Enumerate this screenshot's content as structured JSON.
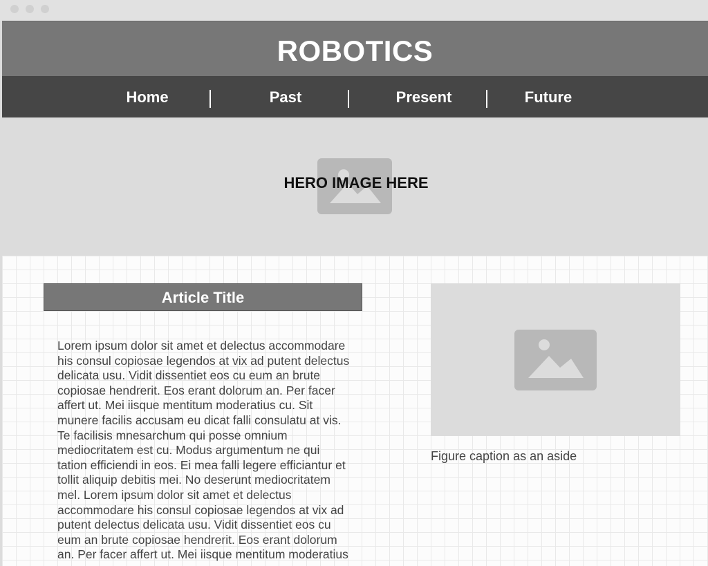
{
  "header": {
    "title": "ROBOTICS"
  },
  "nav": {
    "items": [
      {
        "label": "Home"
      },
      {
        "label": "Past"
      },
      {
        "label": "Present"
      },
      {
        "label": "Future"
      }
    ]
  },
  "hero": {
    "text": "HERO IMAGE HERE",
    "icon": "image-placeholder-icon"
  },
  "article": {
    "title": "Article Title",
    "body": "Lorem ipsum dolor sit amet et delectus accommodare his consul copiosae legendos at vix ad putent delectus delicata usu. Vidit dissentiet eos cu eum an brute copiosae hendrerit. Eos erant dolorum an. Per facer affert ut. Mei iisque mentitum moderatius cu. Sit munere facilis accusam eu dicat falli consulatu at vis. Te facilisis mnesarchum qui posse omnium mediocritatem est cu. Modus argumentum ne qui tation efficiendi in eos. Ei mea falli legere efficiantur et tollit aliquip debitis mei. No deserunt mediocritatem mel. Lorem ipsum dolor sit amet et delectus accommodare his consul copiosae legendos at vix ad putent delectus delicata usu. Vidit dissentiet eos cu eum an brute copiosae hendrerit. Eos erant dolorum an. Per facer affert ut. Mei iisque mentitum moderatius cu."
  },
  "figure": {
    "icon": "image-placeholder-icon",
    "caption": "Figure caption as an aside"
  },
  "colors": {
    "header_bg": "#777777",
    "nav_bg": "#464646",
    "placeholder_bg": "#dcdcdc",
    "placeholder_icon": "#b8b8b8"
  }
}
